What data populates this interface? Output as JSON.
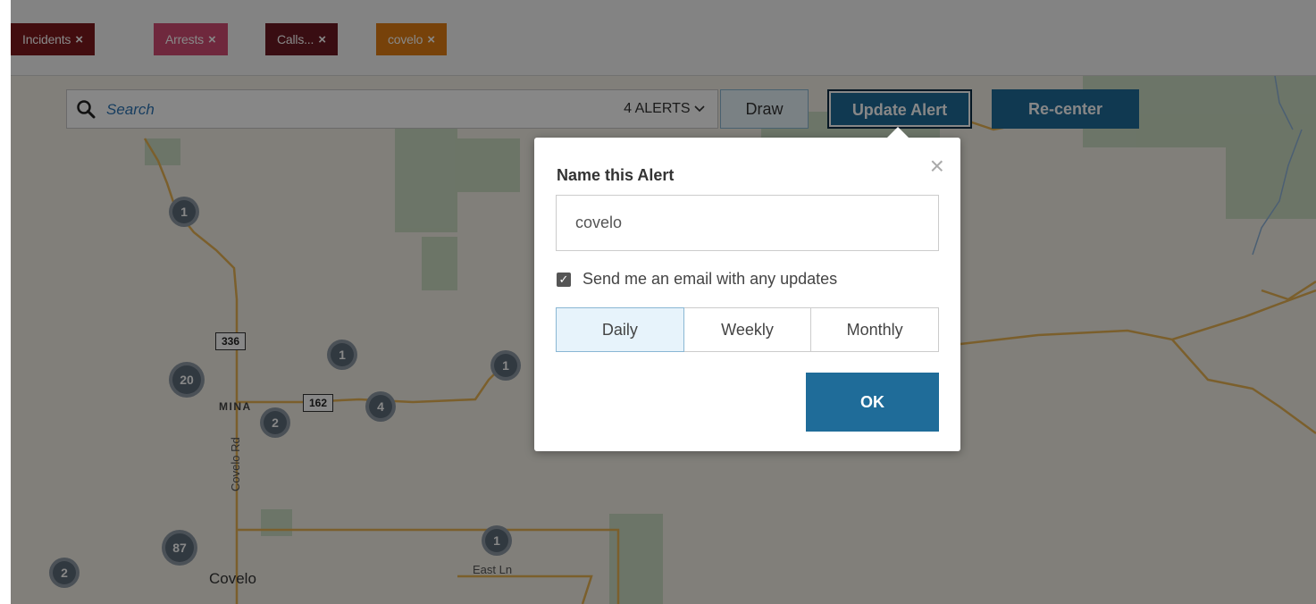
{
  "filters": [
    {
      "label": "Incidents",
      "color": "#7d1a1d"
    },
    {
      "label": "Arrests",
      "color": "#d24d73"
    },
    {
      "label": "Calls...",
      "color": "#6c1a22"
    },
    {
      "label": "covelo",
      "color": "#e07e13"
    }
  ],
  "filter_remove_glyph": "×",
  "toolbar": {
    "search_placeholder": "Search",
    "alerts_label": "4 ALERTS",
    "draw_label": "Draw",
    "update_alert_label": "Update Alert",
    "recenter_label": "Re-center"
  },
  "map": {
    "clusters": [
      "1",
      "20",
      "1",
      "1",
      "2",
      "4",
      "87",
      "1",
      "2"
    ],
    "shields": [
      "336",
      "162"
    ],
    "labels": {
      "mina": "MINA",
      "covelo_rd": "Covelo Rd",
      "covelo": "Covelo",
      "east_ln": "East Ln"
    }
  },
  "alert_dialog": {
    "title": "Name this Alert",
    "name_value": "covelo",
    "email_checkbox_label": "Send me an email with any updates",
    "email_checked": true,
    "frequency_options": [
      "Daily",
      "Weekly",
      "Monthly"
    ],
    "selected_frequency": "Daily",
    "ok_label": "OK"
  },
  "colors": {
    "accent": "#1f6c99",
    "road": "#e8b454"
  }
}
